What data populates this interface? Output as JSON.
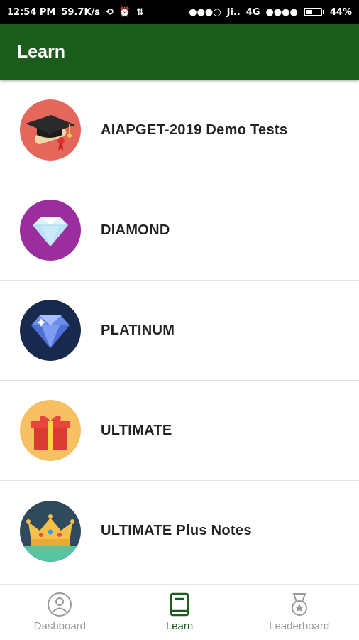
{
  "status_bar": {
    "time": "12:54 PM",
    "speed": "59.7K/s",
    "carrier": "Ji..",
    "network": "4G",
    "battery": "44%",
    "battery_level": 0.44
  },
  "app_bar": {
    "title": "Learn"
  },
  "list": {
    "items": [
      {
        "label": "AIAPGET-2019 Demo Tests",
        "icon": "graduation-cap-icon",
        "bg": "#e5675c"
      },
      {
        "label": "DIAMOND",
        "icon": "diamond-icon",
        "bg": "#9b2d9e"
      },
      {
        "label": "PLATINUM",
        "icon": "platinum-diamond-icon",
        "bg": "#172a4e"
      },
      {
        "label": "ULTIMATE",
        "icon": "gift-box-icon",
        "bg": "#f6c063"
      },
      {
        "label": "ULTIMATE Plus Notes",
        "icon": "crown-icon",
        "bg": "#2f4a5d"
      }
    ]
  },
  "bottom_nav": {
    "tabs": [
      {
        "label": "Dashboard",
        "icon": "user-icon",
        "active": false
      },
      {
        "label": "Learn",
        "icon": "book-icon",
        "active": true
      },
      {
        "label": "Leaderboard",
        "icon": "medal-icon",
        "active": false
      }
    ]
  },
  "colors": {
    "primary": "#1c5c1c",
    "inactive": "#9a9a9a"
  }
}
